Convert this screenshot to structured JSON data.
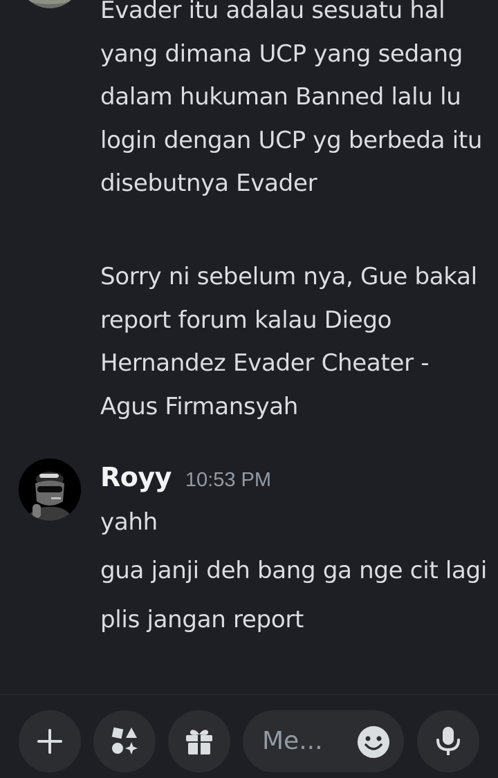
{
  "messages_above": {
    "paragraphs": [
      "Evader itu adalau sesuatu hal yang dimana UCP yang sedang dalam hukuman Banned lalu lu login dengan UCP yg berbeda itu disebutnya Evader",
      "Sorry ni sebelum nya, Gue bakal report forum kalau Diego Hernandez Evader Cheater - Agus Firmansyah"
    ]
  },
  "message_group": {
    "username": "Royy",
    "timestamp": "10:53 PM",
    "lines": [
      "yahh",
      "gua janji deh bang ga nge cit lagi",
      "plis jangan report"
    ]
  },
  "composer": {
    "placeholder": "Me...",
    "icons": {
      "add": "plus-icon",
      "apps": "apps-icon",
      "gift": "gift-icon",
      "emoji": "emoji-icon",
      "mic": "microphone-icon"
    }
  },
  "colors": {
    "background": "#1e1f24",
    "text": "#dbdee1",
    "username": "#f2f3f5",
    "timestamp": "#949ba4",
    "button_bg": "#2b2d31"
  }
}
